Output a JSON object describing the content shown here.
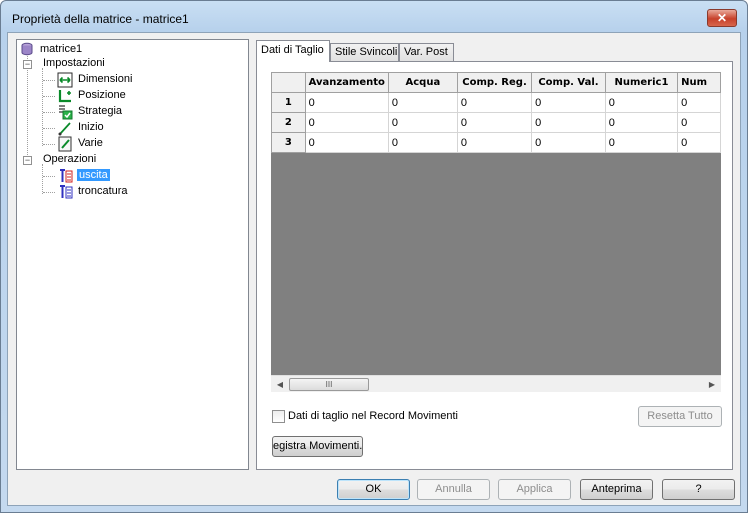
{
  "window": {
    "title": "Proprietà della matrice - matrice1",
    "close_label": "✕"
  },
  "tree": {
    "root": "matrice1",
    "settings_label": "Impostazioni",
    "settings_items": [
      "Dimensioni",
      "Posizione",
      "Strategia",
      "Inizio",
      "Varie"
    ],
    "operations_label": "Operazioni",
    "operations_items": [
      "uscita",
      "troncatura"
    ],
    "selected": "uscita"
  },
  "tabs": [
    "Dati di Taglio",
    "Stile Svincoli",
    "Var. Post"
  ],
  "active_tab": "Dati di Taglio",
  "grid": {
    "columns": [
      "Avanzamento",
      "Acqua",
      "Comp. Reg.",
      "Comp. Val.",
      "Numeric1",
      "Num"
    ],
    "rows": [
      {
        "header": "1",
        "cells": [
          "0",
          "0",
          "0",
          "0",
          "0",
          "0"
        ]
      },
      {
        "header": "2",
        "cells": [
          "0",
          "0",
          "0",
          "0",
          "0",
          "0"
        ]
      },
      {
        "header": "3",
        "cells": [
          "0",
          "0",
          "0",
          "0",
          "0",
          "0"
        ]
      }
    ],
    "scroll_thumb_glyph": "III"
  },
  "checkbox_label": "Dati di taglio nel Record Movimenti",
  "reset_button": "Resetta Tutto",
  "register_button": "egistra Movimenti.",
  "footer": {
    "ok": "OK",
    "cancel": "Annulla",
    "apply": "Applica",
    "preview": "Anteprima",
    "help": "?"
  }
}
